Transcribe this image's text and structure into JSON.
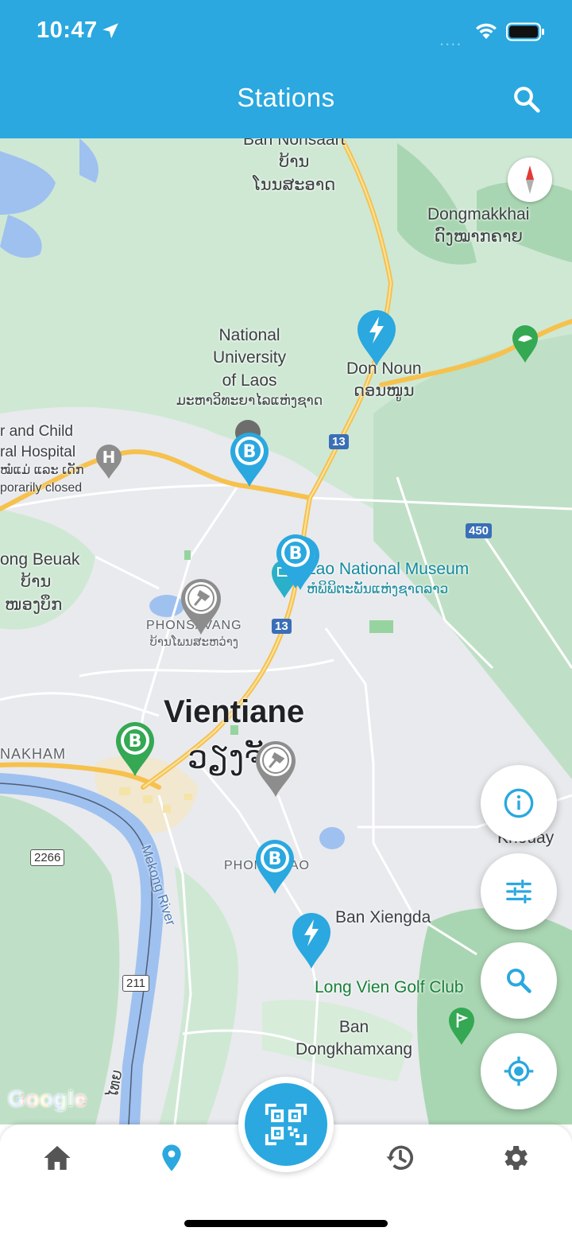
{
  "status_bar": {
    "time": "10:47",
    "signal": "...."
  },
  "header": {
    "title": "Stations"
  },
  "map": {
    "labels": {
      "ban_nonsaart": "Ban Nonsaart",
      "ban_nonsaart_lao1": "ບ້ານ",
      "ban_nonsaart_lao2": "ໂນນສະອາດ",
      "dongmakkhai": "Dongmakkhai",
      "dongmakkhai_lao": "ດົງໝາກຄາຍ",
      "nuol_1": "National",
      "nuol_2": "University",
      "nuol_3": "of Laos",
      "nuol_lao": "ມະຫາວິທະຍາໄລແຫ່ງຊາດ",
      "don_noun": "Don Noun",
      "don_noun_lao": "ດອນໜູນ",
      "hospital_1": "r and Child",
      "hospital_2": "ral Hospital",
      "hospital_3": "ໝໍແມ່ ແລະ ເດັກ",
      "hospital_4": "porarily closed",
      "nong_beuak": "ong Beuak",
      "nong_beuak_lao1": "ບ້ານ",
      "nong_beuak_lao2": "ໜອງບຶກ",
      "museum": "Lao National Museum",
      "museum_lao": "ຫໍພິພິຕະພັນແຫ່ງຊາດລາວ",
      "phonsavang": "PHONSAVANG",
      "phonsavang_lao": "ບ້ານໂພນສະຫວ່າງ",
      "vientiane": "Vientiane",
      "vientiane_lao": "ວຽງຈັ",
      "nakham": "NAKHAM",
      "phonpapao": "PHONPAPAO",
      "khouay": "Khouay",
      "mekong": "Mekong River",
      "ban_xiengda": "Ban Xiengda",
      "golf": "Long Vien Golf Club",
      "ban_dong_1": "Ban",
      "ban_dong_2": "Dongkhamxang",
      "thai_text": "ໄທຍ",
      "route_13a": "13",
      "route_13b": "13",
      "route_450": "450",
      "route_2266": "2266",
      "route_211": "211",
      "google": "Google"
    },
    "pin_colors": {
      "blue": "#2aa8df",
      "green": "#34a853",
      "gray": "#8d8d8d"
    }
  },
  "fabs": {
    "info": "info-icon",
    "filter": "sliders-icon",
    "search": "search-icon",
    "locate": "crosshair-icon"
  },
  "tabbar": {
    "items": [
      "home-icon",
      "map-pin-icon",
      "qr-scan-icon",
      "history-icon",
      "settings-icon"
    ],
    "active": "map-pin-icon",
    "accent": "#2aa8df",
    "inactive": "#555555"
  }
}
